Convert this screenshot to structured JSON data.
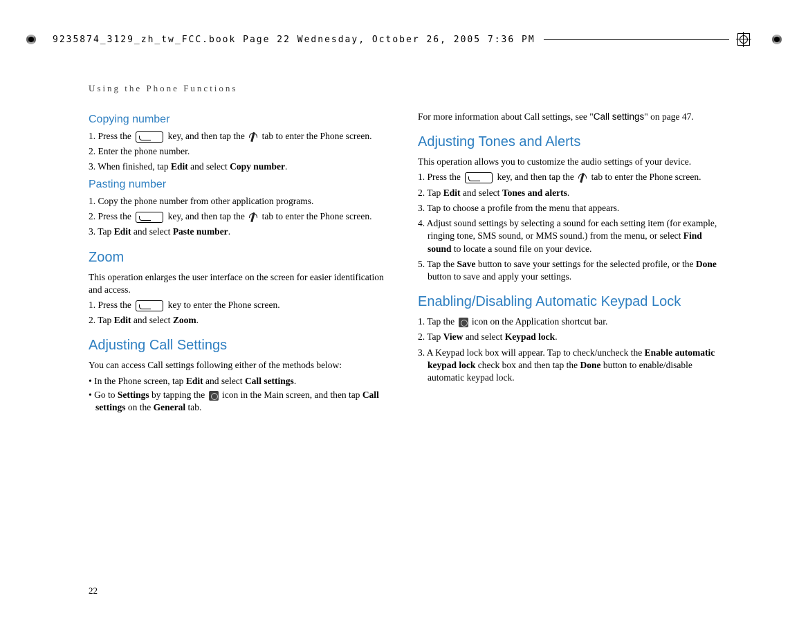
{
  "crop_meta": "9235874_3129_zh_tw_FCC.book  Page 22  Wednesday, October 26, 2005  7:36 PM",
  "running_head": "Using the Phone Functions",
  "page_number": "22",
  "left": {
    "h1": "Copying number",
    "p1a": "1. Press the ",
    "p1b": " key, and then tap the ",
    "p1c": " tab to enter the Phone screen.",
    "p2": "2. Enter the phone number.",
    "p3a": "3. When finished, tap ",
    "p3b": "Edit",
    "p3c": " and select ",
    "p3d": "Copy number",
    "p3e": ".",
    "h2": "Pasting number",
    "q1": "1. Copy the phone number from other application programs.",
    "q2a": "2. Press the ",
    "q2b": " key, and then tap the ",
    "q2c": " tab to enter the Phone screen.",
    "q3a": "3. Tap ",
    "q3b": "Edit",
    "q3c": " and select ",
    "q3d": "Paste number",
    "q3e": ".",
    "h3": "Zoom",
    "z_intro": "This operation enlarges the user interface on the screen for easier identification and access.",
    "z1a": "1. Press the ",
    "z1b": " key to enter the Phone screen.",
    "z2a": "2. Tap ",
    "z2b": "Edit",
    "z2c": " and select ",
    "z2d": "Zoom",
    "z2e": ".",
    "h4": "Adjusting Call Settings",
    "cs_intro": "You can access Call settings following either of the methods below:",
    "cs_b1a": "• In the Phone screen, tap ",
    "cs_b1b": "Edit",
    "cs_b1c": " and select ",
    "cs_b1d": "Call settings",
    "cs_b1e": ".",
    "cs_b2a": "• Go to ",
    "cs_b2b": "Settings",
    "cs_b2c": " by tapping the ",
    "cs_b2d": " icon in the Main screen, and then tap ",
    "cs_b2e": "Call settings",
    "cs_b2f": " on the ",
    "cs_b2g": "General",
    "cs_b2h": " tab."
  },
  "right": {
    "intro_a": "For more information about Call settings, see \"",
    "intro_b": "Call settings",
    "intro_c": "\" on page 47.",
    "h1": "Adjusting Tones and Alerts",
    "ta_intro": "This operation allows you to customize the audio settings of your device.",
    "ta1a": "1. Press the ",
    "ta1b": " key, and then tap the ",
    "ta1c": " tab to enter the Phone screen.",
    "ta2a": "2. Tap ",
    "ta2b": "Edit",
    "ta2c": " and select ",
    "ta2d": "Tones and alerts",
    "ta2e": ".",
    "ta3": "3. Tap to choose a profile from the menu that appears.",
    "ta4a": "4. Adjust sound settings by selecting a sound for each setting item (for example, ringing tone, SMS sound, or MMS sound.) from the menu, or select ",
    "ta4b": "Find sound",
    "ta4c": " to locate a sound file on your device.",
    "ta5a": "5. Tap the ",
    "ta5b": "Save",
    "ta5c": " button to save your settings for the selected profile, or the ",
    "ta5d": "Done",
    "ta5e": " button to save and apply your settings.",
    "h2": "Enabling/Disabling Automatic Keypad Lock",
    "kl1a": "1. Tap the ",
    "kl1b": " icon on the Application shortcut bar.",
    "kl2a": "2. Tap ",
    "kl2b": "View",
    "kl2c": " and select ",
    "kl2d": "Keypad lock",
    "kl2e": ".",
    "kl3a": "3. A Keypad lock box will appear. Tap to check/uncheck the ",
    "kl3b": "Enable automatic keypad lock",
    "kl3c": " check box and then tap the ",
    "kl3d": "Done",
    "kl3e": " button to enable/disable automatic keypad lock."
  }
}
